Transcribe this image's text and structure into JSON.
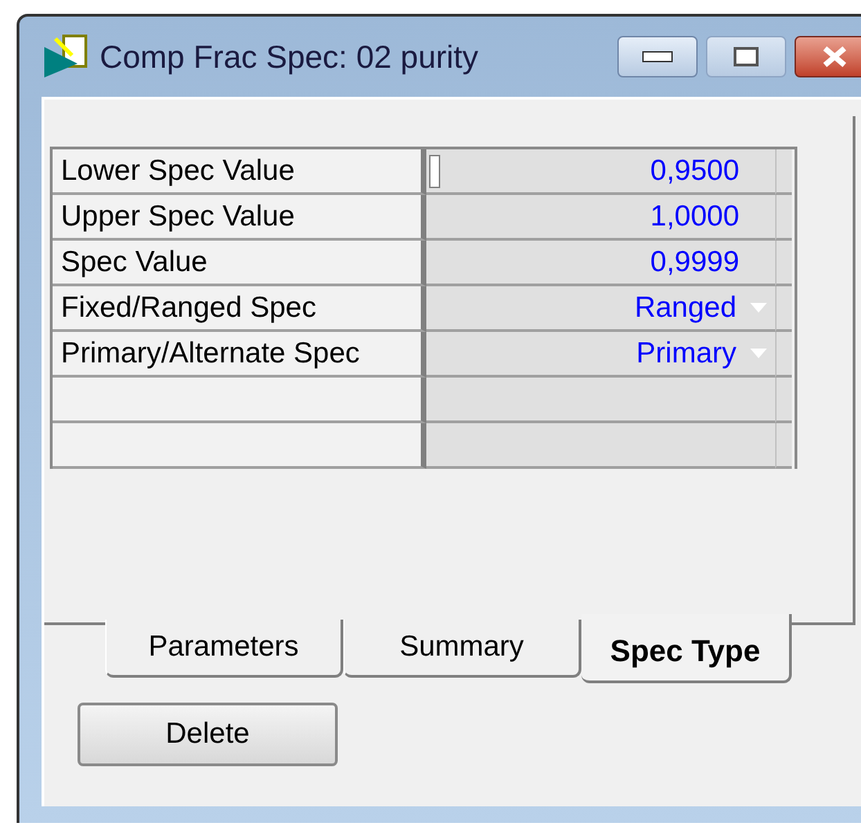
{
  "window": {
    "title": "Comp Frac Spec: 02 purity"
  },
  "rows": [
    {
      "kind": "number",
      "label": "Lower Spec Value",
      "value": "0,9500",
      "focused": true
    },
    {
      "kind": "number",
      "label": "Upper Spec Value",
      "value": "1,0000",
      "focused": false
    },
    {
      "kind": "number",
      "label": "Spec Value",
      "value": "0,9999",
      "focused": false
    },
    {
      "kind": "dropdown",
      "label": "Fixed/Ranged Spec",
      "value": "Ranged",
      "focused": false
    },
    {
      "kind": "dropdown",
      "label": "Primary/Alternate Spec",
      "value": "Primary",
      "focused": false
    },
    {
      "kind": "blank",
      "focused": false
    },
    {
      "kind": "blank",
      "focused": false
    }
  ],
  "tabs": [
    {
      "label": "Parameters",
      "selected": false
    },
    {
      "label": "Summary",
      "selected": false
    },
    {
      "label": "Spec Type",
      "selected": true
    }
  ],
  "buttons": [
    "Delete"
  ]
}
